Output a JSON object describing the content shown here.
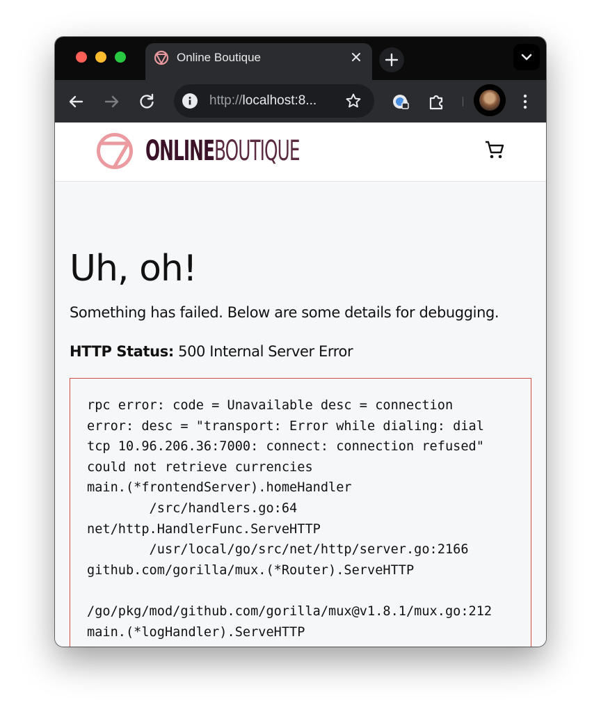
{
  "browser": {
    "tab_title": "Online Boutique",
    "url_prefix": "http://",
    "url_host": "localhost:8..."
  },
  "site": {
    "logo_bold": "ONLINE",
    "logo_light": "BOUTIQUE",
    "brand_color": "#3b1227",
    "logo_mark_color": "#eb9a9f"
  },
  "error": {
    "title": "Uh, oh!",
    "message": "Something has failed. Below are some details for debugging.",
    "status_label": "HTTP Status:",
    "status_value": " 500 Internal Server Error",
    "details": "rpc error: code = Unavailable desc = connection\nerror: desc = \"transport: Error while dialing: dial\ntcp 10.96.206.36:7000: connect: connection refused\"\ncould not retrieve currencies\nmain.(*frontendServer).homeHandler\n        /src/handlers.go:64\nnet/http.HandlerFunc.ServeHTTP\n        /usr/local/go/src/net/http/server.go:2166\ngithub.com/gorilla/mux.(*Router).ServeHTTP\n\n/go/pkg/mod/github.com/gorilla/mux@v1.8.1/mux.go:212\nmain.(*logHandler).ServeHTTP",
    "border_color": "#d04b40"
  }
}
